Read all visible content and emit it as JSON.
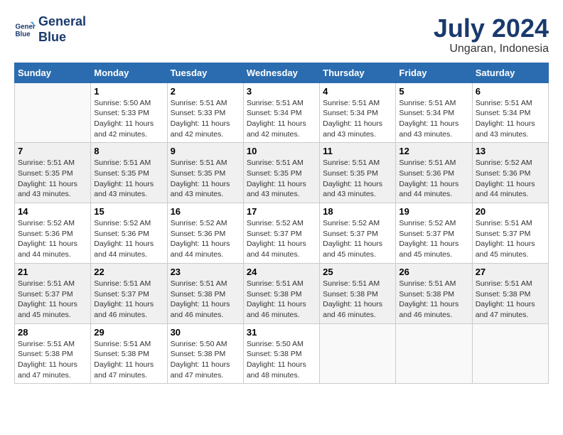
{
  "header": {
    "logo_line1": "General",
    "logo_line2": "Blue",
    "month_year": "July 2024",
    "location": "Ungaran, Indonesia"
  },
  "days_of_week": [
    "Sunday",
    "Monday",
    "Tuesday",
    "Wednesday",
    "Thursday",
    "Friday",
    "Saturday"
  ],
  "weeks": [
    [
      {
        "day": "",
        "info": ""
      },
      {
        "day": "1",
        "info": "Sunrise: 5:50 AM\nSunset: 5:33 PM\nDaylight: 11 hours\nand 42 minutes."
      },
      {
        "day": "2",
        "info": "Sunrise: 5:51 AM\nSunset: 5:33 PM\nDaylight: 11 hours\nand 42 minutes."
      },
      {
        "day": "3",
        "info": "Sunrise: 5:51 AM\nSunset: 5:34 PM\nDaylight: 11 hours\nand 42 minutes."
      },
      {
        "day": "4",
        "info": "Sunrise: 5:51 AM\nSunset: 5:34 PM\nDaylight: 11 hours\nand 43 minutes."
      },
      {
        "day": "5",
        "info": "Sunrise: 5:51 AM\nSunset: 5:34 PM\nDaylight: 11 hours\nand 43 minutes."
      },
      {
        "day": "6",
        "info": "Sunrise: 5:51 AM\nSunset: 5:34 PM\nDaylight: 11 hours\nand 43 minutes."
      }
    ],
    [
      {
        "day": "7",
        "info": "Sunrise: 5:51 AM\nSunset: 5:35 PM\nDaylight: 11 hours\nand 43 minutes."
      },
      {
        "day": "8",
        "info": "Sunrise: 5:51 AM\nSunset: 5:35 PM\nDaylight: 11 hours\nand 43 minutes."
      },
      {
        "day": "9",
        "info": "Sunrise: 5:51 AM\nSunset: 5:35 PM\nDaylight: 11 hours\nand 43 minutes."
      },
      {
        "day": "10",
        "info": "Sunrise: 5:51 AM\nSunset: 5:35 PM\nDaylight: 11 hours\nand 43 minutes."
      },
      {
        "day": "11",
        "info": "Sunrise: 5:51 AM\nSunset: 5:35 PM\nDaylight: 11 hours\nand 43 minutes."
      },
      {
        "day": "12",
        "info": "Sunrise: 5:51 AM\nSunset: 5:36 PM\nDaylight: 11 hours\nand 44 minutes."
      },
      {
        "day": "13",
        "info": "Sunrise: 5:52 AM\nSunset: 5:36 PM\nDaylight: 11 hours\nand 44 minutes."
      }
    ],
    [
      {
        "day": "14",
        "info": "Sunrise: 5:52 AM\nSunset: 5:36 PM\nDaylight: 11 hours\nand 44 minutes."
      },
      {
        "day": "15",
        "info": "Sunrise: 5:52 AM\nSunset: 5:36 PM\nDaylight: 11 hours\nand 44 minutes."
      },
      {
        "day": "16",
        "info": "Sunrise: 5:52 AM\nSunset: 5:36 PM\nDaylight: 11 hours\nand 44 minutes."
      },
      {
        "day": "17",
        "info": "Sunrise: 5:52 AM\nSunset: 5:37 PM\nDaylight: 11 hours\nand 44 minutes."
      },
      {
        "day": "18",
        "info": "Sunrise: 5:52 AM\nSunset: 5:37 PM\nDaylight: 11 hours\nand 45 minutes."
      },
      {
        "day": "19",
        "info": "Sunrise: 5:52 AM\nSunset: 5:37 PM\nDaylight: 11 hours\nand 45 minutes."
      },
      {
        "day": "20",
        "info": "Sunrise: 5:51 AM\nSunset: 5:37 PM\nDaylight: 11 hours\nand 45 minutes."
      }
    ],
    [
      {
        "day": "21",
        "info": "Sunrise: 5:51 AM\nSunset: 5:37 PM\nDaylight: 11 hours\nand 45 minutes."
      },
      {
        "day": "22",
        "info": "Sunrise: 5:51 AM\nSunset: 5:37 PM\nDaylight: 11 hours\nand 46 minutes."
      },
      {
        "day": "23",
        "info": "Sunrise: 5:51 AM\nSunset: 5:38 PM\nDaylight: 11 hours\nand 46 minutes."
      },
      {
        "day": "24",
        "info": "Sunrise: 5:51 AM\nSunset: 5:38 PM\nDaylight: 11 hours\nand 46 minutes."
      },
      {
        "day": "25",
        "info": "Sunrise: 5:51 AM\nSunset: 5:38 PM\nDaylight: 11 hours\nand 46 minutes."
      },
      {
        "day": "26",
        "info": "Sunrise: 5:51 AM\nSunset: 5:38 PM\nDaylight: 11 hours\nand 46 minutes."
      },
      {
        "day": "27",
        "info": "Sunrise: 5:51 AM\nSunset: 5:38 PM\nDaylight: 11 hours\nand 47 minutes."
      }
    ],
    [
      {
        "day": "28",
        "info": "Sunrise: 5:51 AM\nSunset: 5:38 PM\nDaylight: 11 hours\nand 47 minutes."
      },
      {
        "day": "29",
        "info": "Sunrise: 5:51 AM\nSunset: 5:38 PM\nDaylight: 11 hours\nand 47 minutes."
      },
      {
        "day": "30",
        "info": "Sunrise: 5:50 AM\nSunset: 5:38 PM\nDaylight: 11 hours\nand 47 minutes."
      },
      {
        "day": "31",
        "info": "Sunrise: 5:50 AM\nSunset: 5:38 PM\nDaylight: 11 hours\nand 48 minutes."
      },
      {
        "day": "",
        "info": ""
      },
      {
        "day": "",
        "info": ""
      },
      {
        "day": "",
        "info": ""
      }
    ]
  ]
}
